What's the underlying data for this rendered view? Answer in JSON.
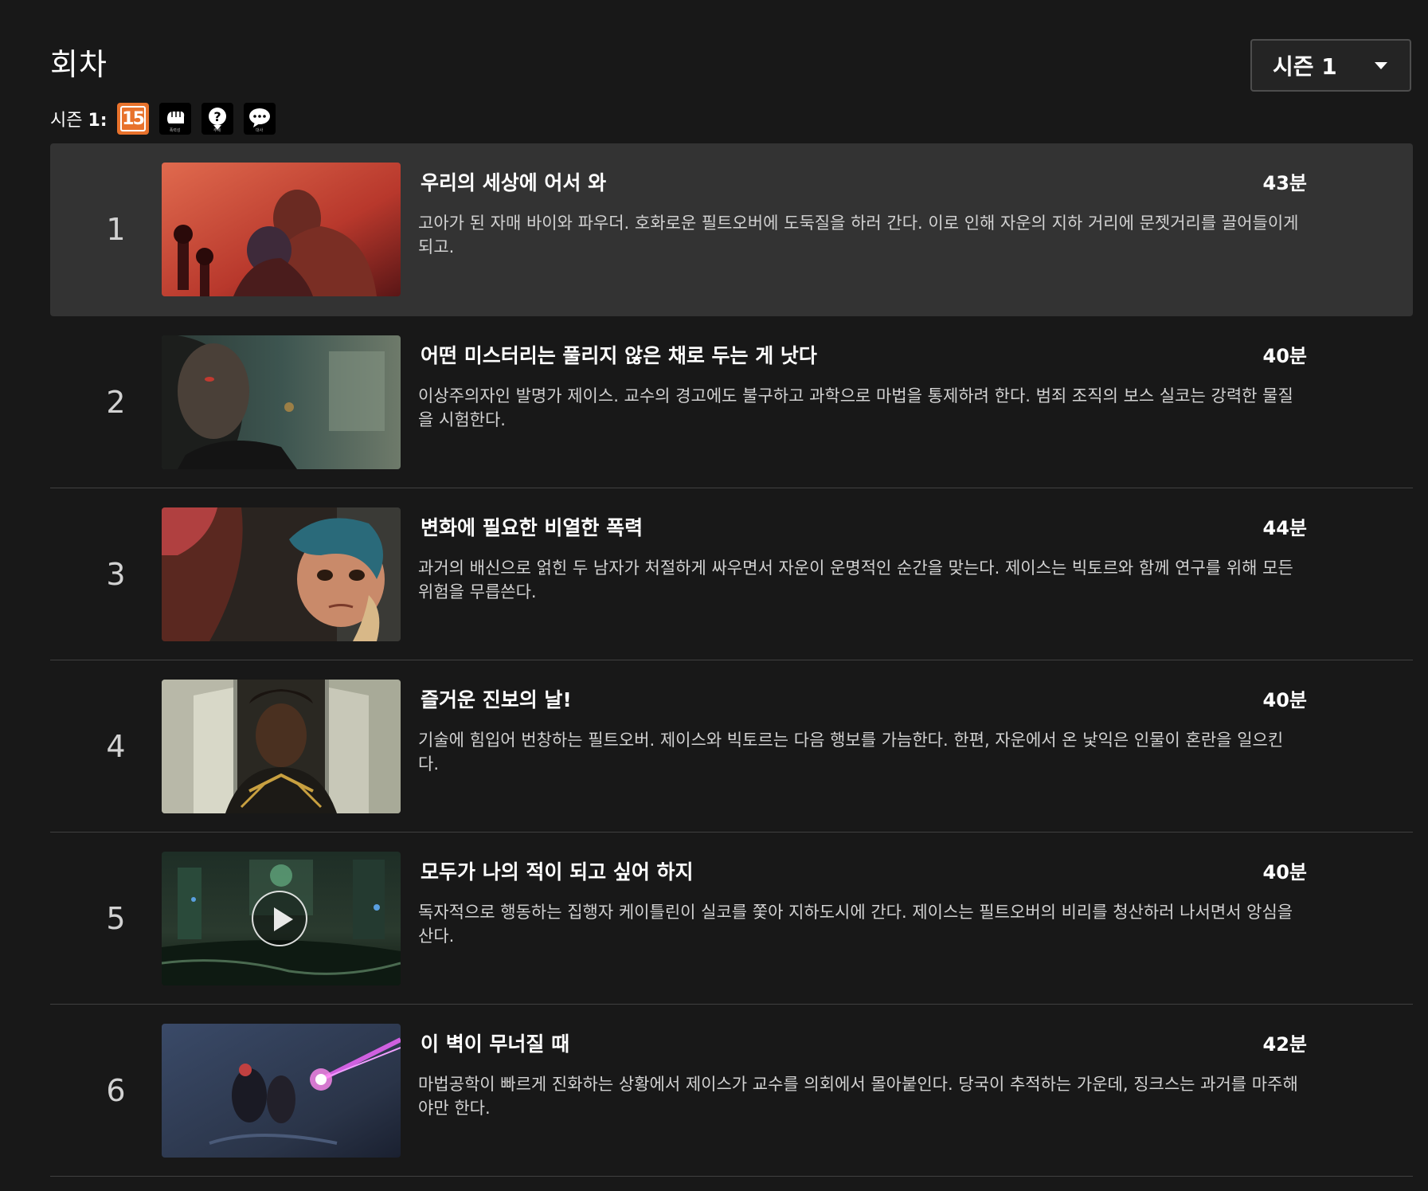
{
  "header": {
    "title": "회차",
    "season_selector": {
      "label": "시즌 1"
    }
  },
  "rating": {
    "prefix": "시즌",
    "prefix_bold": "1:",
    "age_rating": "15",
    "descriptors": [
      {
        "icon": "violence-fist-icon",
        "caption": "폭력성"
      },
      {
        "icon": "theme-question-icon",
        "caption": "주제"
      },
      {
        "icon": "dialogue-speech-icon",
        "caption": "대사"
      }
    ],
    "age_color": "#e8722c"
  },
  "episodes": [
    {
      "number": "1",
      "title": "우리의 세상에 어서 와",
      "duration": "43분",
      "description": "고아가 된 자매 바이와 파우더. 호화로운 필트오버에 도둑질을 하러 간다. 이로 인해 자운의 지하 거리에 문젯거리를 끌어들이게 되고.",
      "active": true
    },
    {
      "number": "2",
      "title": "어떤 미스터리는 풀리지 않은 채로 두는 게 낫다",
      "duration": "40분",
      "description": "이상주의자인 발명가 제이스. 교수의 경고에도 불구하고 과학으로 마법을 통제하려 한다. 범죄 조직의 보스 실코는 강력한 물질을 시험한다."
    },
    {
      "number": "3",
      "title": "변화에 필요한 비열한 폭력",
      "duration": "44분",
      "description": "과거의 배신으로 얽힌 두 남자가 처절하게 싸우면서 자운이 운명적인 순간을 맞는다. 제이스는 빅토르와 함께 연구를 위해 모든 위험을 무릅쓴다."
    },
    {
      "number": "4",
      "title": "즐거운 진보의 날!",
      "duration": "40분",
      "description": "기술에 힘입어 번창하는 필트오버. 제이스와 빅토르는 다음 행보를 가늠한다. 한편, 자운에서 온 낯익은 인물이 혼란을 일으킨다."
    },
    {
      "number": "5",
      "title": "모두가 나의 적이 되고 싶어 하지",
      "duration": "40분",
      "description": "독자적으로 행동하는 집행자 케이틀린이 실코를 쫓아 지하도시에 간다. 제이스는 필트오버의 비리를 청산하러 나서면서 앙심을 산다.",
      "hover_play": true
    },
    {
      "number": "6",
      "title": "이 벽이 무너질 때",
      "duration": "42분",
      "description": "마법공학이 빠르게 진화하는 상황에서 제이스가 교수를 의회에서 몰아붙인다. 당국이 추적하는 가운데, 징크스는 과거를 마주해야만 한다."
    }
  ]
}
